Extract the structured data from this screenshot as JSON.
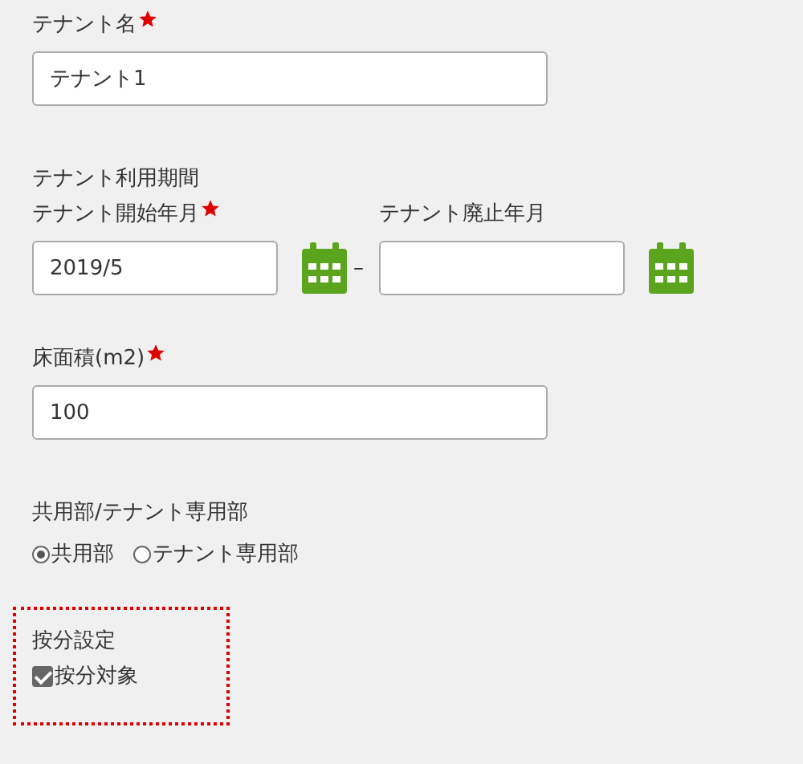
{
  "tenant_name": {
    "label": "テナント名",
    "required": true,
    "value": "テナント1"
  },
  "period": {
    "heading": "テナント利用期間",
    "separator": "–",
    "start": {
      "label": "テナント開始年月",
      "required": true,
      "value": "2019/5"
    },
    "end": {
      "label": "テナント廃止年月",
      "required": false
    }
  },
  "floor_area": {
    "label": "床面積(m2)",
    "required": true,
    "value": "100"
  },
  "area_type": {
    "heading": "共用部/テナント専用部",
    "options": [
      {
        "label": "共用部",
        "selected": true
      },
      {
        "label": "テナント専用部",
        "selected": false
      }
    ]
  },
  "allocation": {
    "heading": "按分設定",
    "checkbox": {
      "label": "按分対象",
      "checked": true
    }
  }
}
